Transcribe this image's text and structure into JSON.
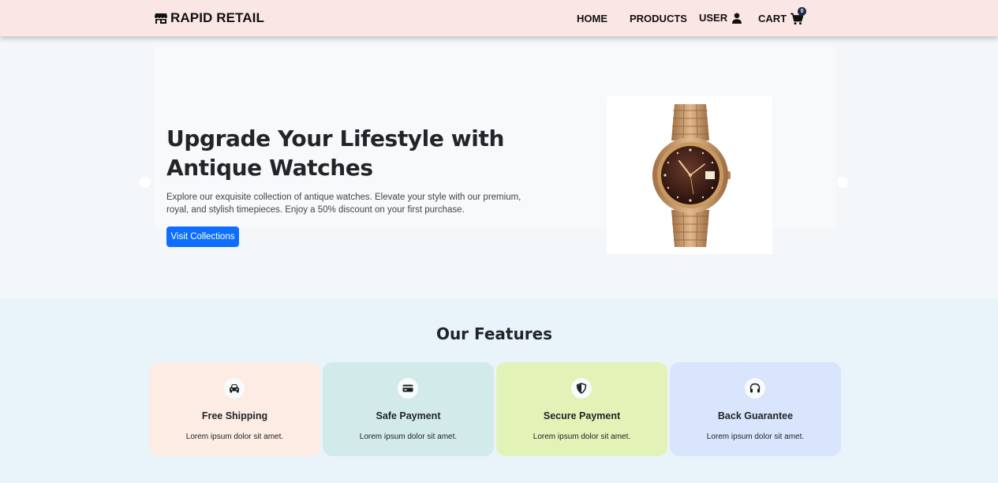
{
  "navbar": {
    "brand_icon": "shop-icon",
    "brand": "RAPID RETAIL",
    "links": {
      "home": "HOME",
      "products": "PRODUCTS",
      "user": "USER",
      "cart": "CART"
    },
    "user_icon": "user-icon",
    "cart_icon": "cart-icon",
    "cart_count": "0"
  },
  "hero": {
    "title": "Upgrade Your Lifestyle with Antique Watches",
    "description": "Explore our exquisite collection of antique watches. Elevate your style with our premium, royal, and stylish timepieces. Enjoy a 50% discount on your first purchase.",
    "button": "Visit Collections",
    "image_icon": "watch-image",
    "prev_icon": "carousel-prev-icon",
    "next_icon": "carousel-next-icon"
  },
  "features": {
    "title": "Our Features",
    "items": [
      {
        "title": "Free Shipping",
        "desc": "Lorem ipsum dolor sit amet.",
        "icon": "car-icon",
        "bg": "#fdece4"
      },
      {
        "title": "Safe Payment",
        "desc": "Lorem ipsum dolor sit amet.",
        "icon": "credit-card-icon",
        "bg": "#d2ebea"
      },
      {
        "title": "Secure Payment",
        "desc": "Lorem ipsum dolor sit amet.",
        "icon": "shield-icon",
        "bg": "#e3f2b6"
      },
      {
        "title": "Back Guarantee",
        "desc": "Lorem ipsum dolor sit amet.",
        "icon": "headphones-icon",
        "bg": "#d8e5fd"
      }
    ]
  },
  "colors": {
    "navbar_bg": "#fbe6e6",
    "primary": "#0d6efd",
    "hero_bg": "#f3f7fa",
    "features_bg": "#e8f4f9",
    "badge": "#1a2b4a"
  }
}
